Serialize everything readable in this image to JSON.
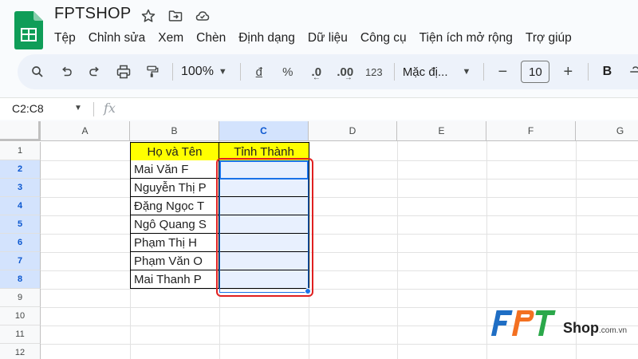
{
  "app": {
    "doc_title": "FPTSHOP",
    "logo_icon": "google-sheets-logo",
    "title_icons": [
      "star-icon",
      "move-to-folder-icon",
      "cloud-status-icon"
    ]
  },
  "menu": {
    "items": [
      "Tệp",
      "Chỉnh sửa",
      "Xem",
      "Chèn",
      "Định dạng",
      "Dữ liệu",
      "Công cụ",
      "Tiện ích mở rộng",
      "Trợ giúp"
    ]
  },
  "toolbar": {
    "zoom": "100%",
    "currency": "đ",
    "percent": "%",
    "decrease_decimal": ".0",
    "increase_decimal": ".00",
    "number_format": "123",
    "font_name": "Mặc đị...",
    "font_size": "10",
    "bold": "B",
    "minus": "−",
    "plus": "+"
  },
  "formula_bar": {
    "name_box": "C2:C8",
    "fx": "fx",
    "content": ""
  },
  "grid": {
    "columns": [
      "A",
      "B",
      "C",
      "D",
      "E",
      "F",
      "G"
    ],
    "selected_column": "C",
    "rows": [
      "1",
      "2",
      "3",
      "4",
      "5",
      "6",
      "7",
      "8",
      "9",
      "10",
      "11",
      "12"
    ],
    "selected_rows": [
      "2",
      "3",
      "4",
      "5",
      "6",
      "7",
      "8"
    ],
    "header_row": {
      "B1": "Họ và Tên",
      "C1": "Tỉnh Thành"
    },
    "names": [
      "Mai Văn F",
      "Nguyễn Thị P",
      "Đặng Ngọc T",
      "Ngô Quang S",
      "Phạm Thị H",
      "Phạm Văn O",
      "Mai Thanh P"
    ],
    "accent_blue": "#1a73e8",
    "highlight_red": "#e02020",
    "header_fill": "#ffff00"
  },
  "watermark": {
    "brand": "FPT",
    "suffix": "Shop",
    "domain": ".com.vn"
  }
}
